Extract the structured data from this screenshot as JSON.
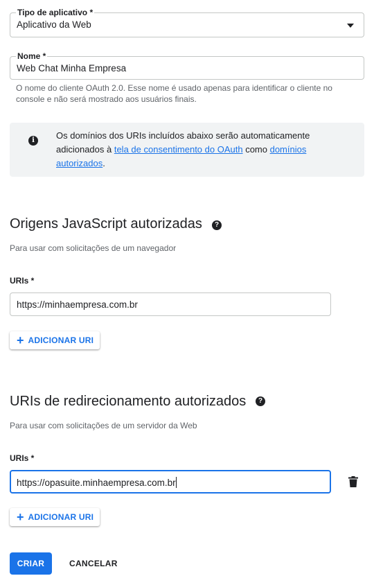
{
  "app_type": {
    "label": "Tipo de aplicativo *",
    "value": "Aplicativo da Web"
  },
  "name_field": {
    "label": "Nome *",
    "value": "Web Chat Minha Empresa",
    "hint": "O nome do cliente OAuth 2.0. Esse nome é usado apenas para identificar o cliente no console e não será mostrado aos usuários finais."
  },
  "info": {
    "text_before": "Os domínios dos URIs incluídos abaixo serão automaticamente adicionados à ",
    "link1": "tela de consentimento do OAuth",
    "text_middle": " como ",
    "link2": "domínios autorizados",
    "text_after": "."
  },
  "js_origins": {
    "title": "Origens JavaScript autorizadas",
    "subtitle": "Para usar com solicitações de um navegador",
    "uris_label": "URIs *",
    "uri_value": "https://minhaempresa.com.br",
    "add_button": "ADICIONAR URI"
  },
  "redirect_uris": {
    "title": "URIs de redirecionamento autorizados",
    "subtitle": "Para usar com solicitações de um servidor da Web",
    "uris_label": "URIs *",
    "uri_value": "https://opasuite.minhaempresa.com.br",
    "add_button": "ADICIONAR URI"
  },
  "actions": {
    "create": "CRIAR",
    "cancel": "CANCELAR"
  },
  "colors": {
    "accent": "#1a73e8",
    "info_bg": "#f1f3f4"
  }
}
